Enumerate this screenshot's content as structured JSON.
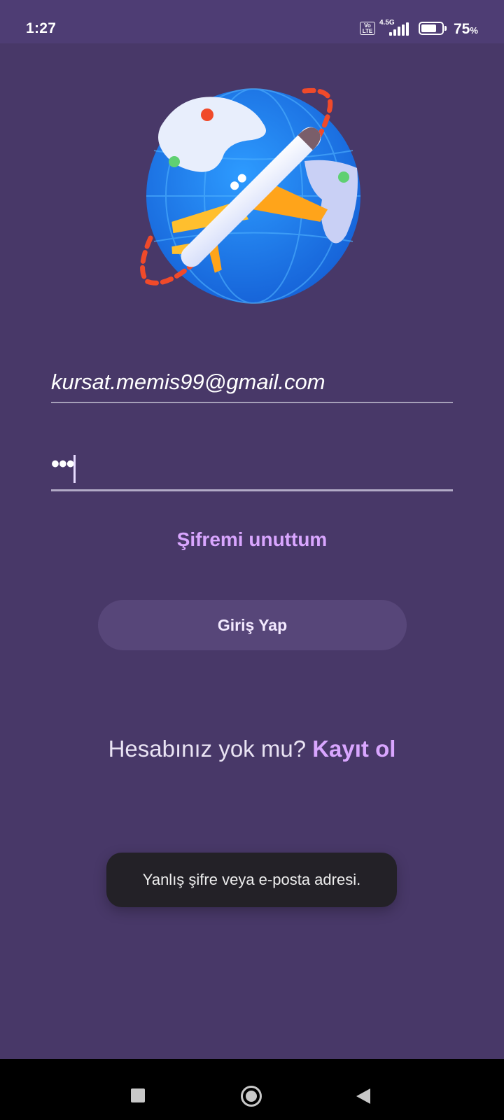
{
  "status_bar": {
    "time": "1:27",
    "volte": "Vo LTE",
    "network": "4.5G",
    "battery_percent": "75",
    "battery_unit": "%",
    "battery_level": 0.75,
    "signal_bars": 4
  },
  "logo": {
    "icon": "globe-airplane-logo",
    "colors": {
      "globe": "#1e78e6",
      "plane_wing": "#ffbf2e",
      "route": "#f04a2a"
    }
  },
  "form": {
    "email_value": "kursat.memis99@gmail.com",
    "password_masked": "•••",
    "forgot_label": "Şifremi unuttum",
    "login_label": "Giriş Yap"
  },
  "signup": {
    "prompt": "Hesabınız yok mu?",
    "link": "Kayıt ol"
  },
  "toast": {
    "message": "Yanlış şifre veya e-posta adresi."
  },
  "nav_bar": {
    "icons": [
      "recents-icon",
      "home-icon",
      "back-icon"
    ]
  },
  "theme": {
    "background": "#483868",
    "accent": "#d9a6ff",
    "button": "#574679"
  }
}
